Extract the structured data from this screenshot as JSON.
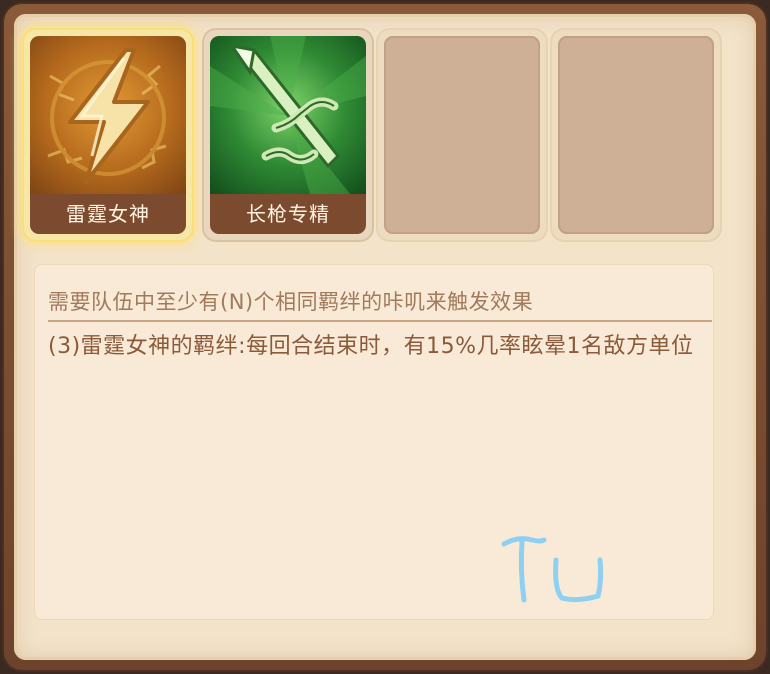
{
  "bonds": [
    {
      "label": "雷霆女神",
      "icon": "lightning-icon",
      "state": "selected"
    },
    {
      "label": "长枪专精",
      "icon": "lance-icon",
      "state": "normal"
    },
    {
      "label": "",
      "icon": "",
      "state": "empty"
    },
    {
      "label": "",
      "icon": "",
      "state": "empty"
    }
  ],
  "description": {
    "header": "需要队伍中至少有(N)个相同羁绊的咔叽来触发效果",
    "effect": "(3)雷霆女神的羁绊:每回合结束时，有15%几率眩晕1名敌方单位"
  },
  "watermark": "TU",
  "colors": {
    "panel": "#f3e3c9",
    "frame": "#7c4a2f",
    "header_text": "#a07a5b",
    "body_text": "#8b5a3a",
    "selected_glow": "#f7e7a6"
  }
}
